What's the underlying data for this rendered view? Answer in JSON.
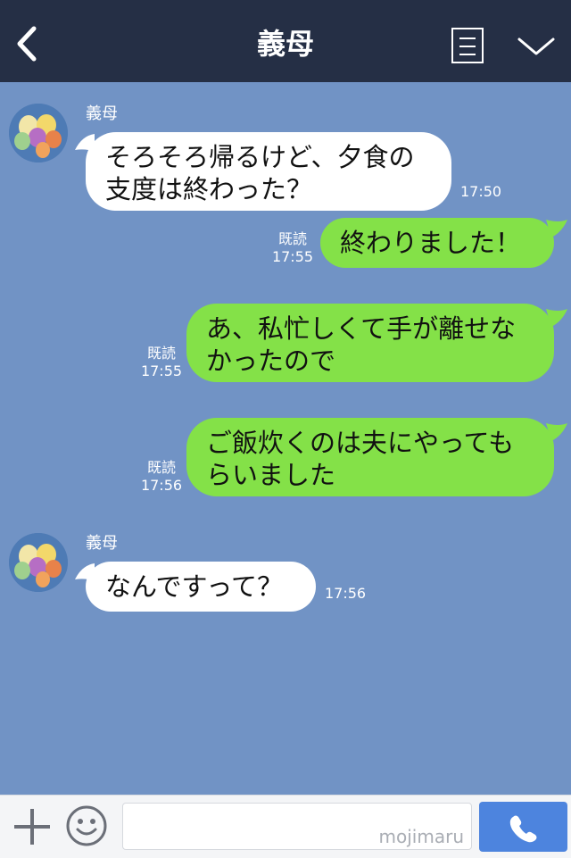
{
  "header": {
    "title": "義母",
    "colors": {
      "bar": "#252f45",
      "chat_bg": "#7193c5",
      "incoming_bubble": "#ffffff",
      "outgoing_bubble": "#84e148",
      "send_button": "#4d84de"
    }
  },
  "messages": [
    {
      "direction": "incoming",
      "sender": "義母",
      "lines": [
        "そろそろ帰るけど、夕食の",
        "支度は終わった？"
      ],
      "time": "17:50"
    },
    {
      "direction": "outgoing",
      "read": "既読",
      "lines": [
        "終わりました！"
      ],
      "time": "17:55"
    },
    {
      "direction": "outgoing",
      "read": "既読",
      "lines": [
        "あ、私忙しくて手が離せな",
        "かったので"
      ],
      "time": "17:55"
    },
    {
      "direction": "outgoing",
      "read": "既読",
      "lines": [
        "ご飯炊くのは夫にやっても",
        "らいました"
      ],
      "time": "17:56"
    },
    {
      "direction": "incoming",
      "sender": "義母",
      "lines": [
        "なんですって？"
      ],
      "time": "17:56"
    }
  ],
  "footer": {
    "watermark": "mojimaru",
    "icons": [
      "plus-icon",
      "smiley-icon",
      "phone-icon"
    ]
  }
}
